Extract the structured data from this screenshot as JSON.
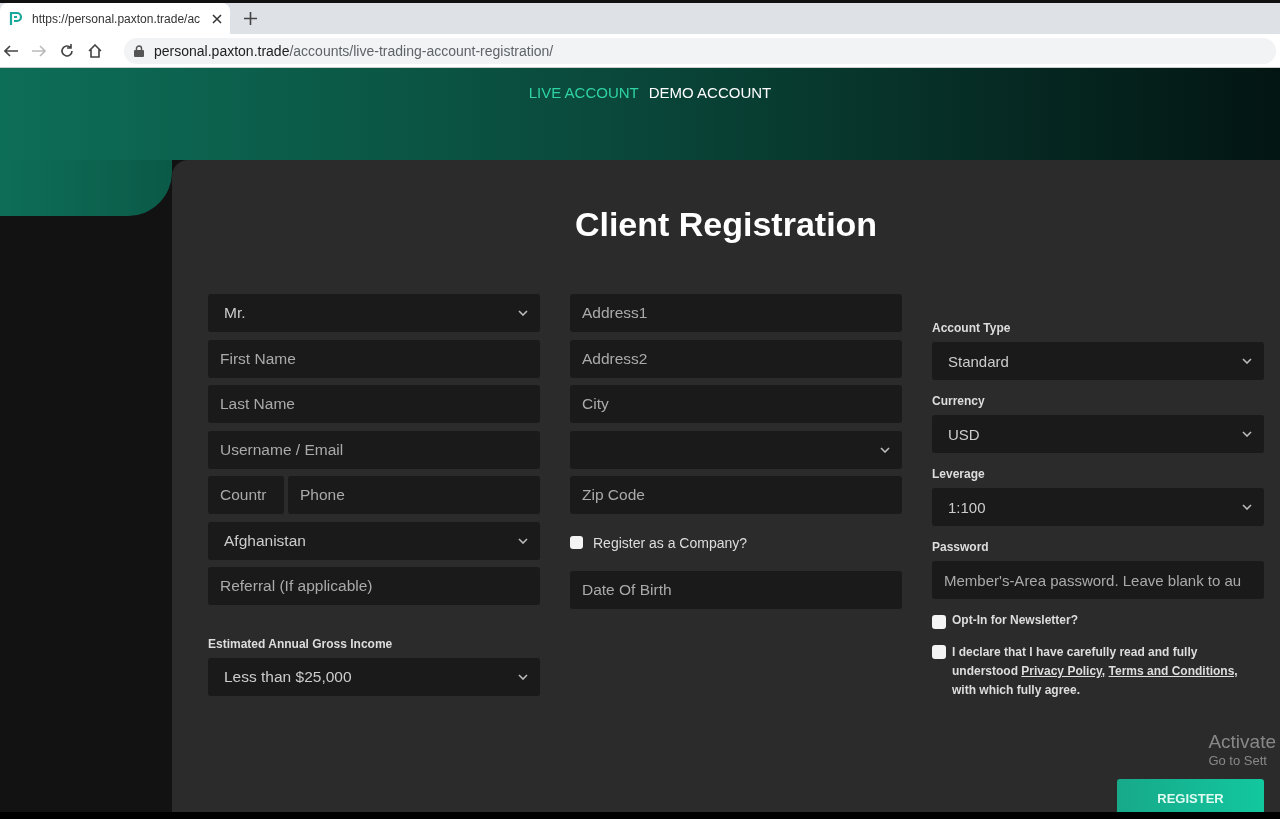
{
  "browser": {
    "tab_title": "https://personal.paxton.trade/ac",
    "url_host": "personal.paxton.trade",
    "url_path": "/accounts/live-trading-account-registration/"
  },
  "nav": [
    {
      "label": "LIVE ACCOUNT",
      "selected": true
    },
    {
      "label": "DEMO ACCOUNT",
      "selected": false
    }
  ],
  "title": "Client Registration",
  "column_1": [
    {
      "kind": "select",
      "value": "Mr."
    },
    {
      "kind": "input",
      "placeholder": "First Name"
    },
    {
      "kind": "input",
      "placeholder": "Last Name"
    },
    {
      "kind": "input",
      "placeholder": "Username / Email"
    },
    {
      "kind": "split",
      "parts": [
        {
          "placeholder": "Countr"
        },
        {
          "placeholder": "Phone"
        }
      ]
    },
    {
      "kind": "select",
      "value": "Afghanistan"
    },
    {
      "kind": "input",
      "placeholder": "Referral (If applicable)"
    },
    {
      "kind": "labeled_select",
      "label": "Estimated Annual Gross Income",
      "value": "Less than $25,000"
    }
  ],
  "column_2": [
    {
      "kind": "input",
      "placeholder": "Address1"
    },
    {
      "kind": "input",
      "placeholder": "Address2"
    },
    {
      "kind": "input",
      "placeholder": "City"
    },
    {
      "kind": "select"
    },
    {
      "kind": "input",
      "placeholder": "Zip Code"
    },
    {
      "kind": "checkbox",
      "label": "Register as a Company?",
      "checked": false
    },
    {
      "kind": "input",
      "placeholder": "Date Of Birth"
    }
  ],
  "column_3": [
    {
      "kind": "labeled_select",
      "label": "Account Type",
      "value": "Standard"
    },
    {
      "kind": "labeled_select",
      "label": "Currency",
      "value": "USD"
    },
    {
      "kind": "labeled_select",
      "label": "Leverage",
      "value": "1:100"
    },
    {
      "kind": "labeled_input",
      "label": "Password",
      "placeholder": "Member's-Area password. Leave blank to au"
    },
    {
      "kind": "checkbox",
      "label": "Opt-In for Newsletter?",
      "checked": false
    },
    {
      "kind": "declaration",
      "checked": false,
      "text_before": "I declare that I have carefully read and fully understood",
      "links": [
        "Privacy Policy,",
        "Terms and Conditions,"
      ],
      "text_after": "with which fully agree."
    }
  ],
  "register_button": "REGISTER",
  "os_notice": {
    "line_1": "Activate",
    "line_2": "Go to Sett"
  }
}
